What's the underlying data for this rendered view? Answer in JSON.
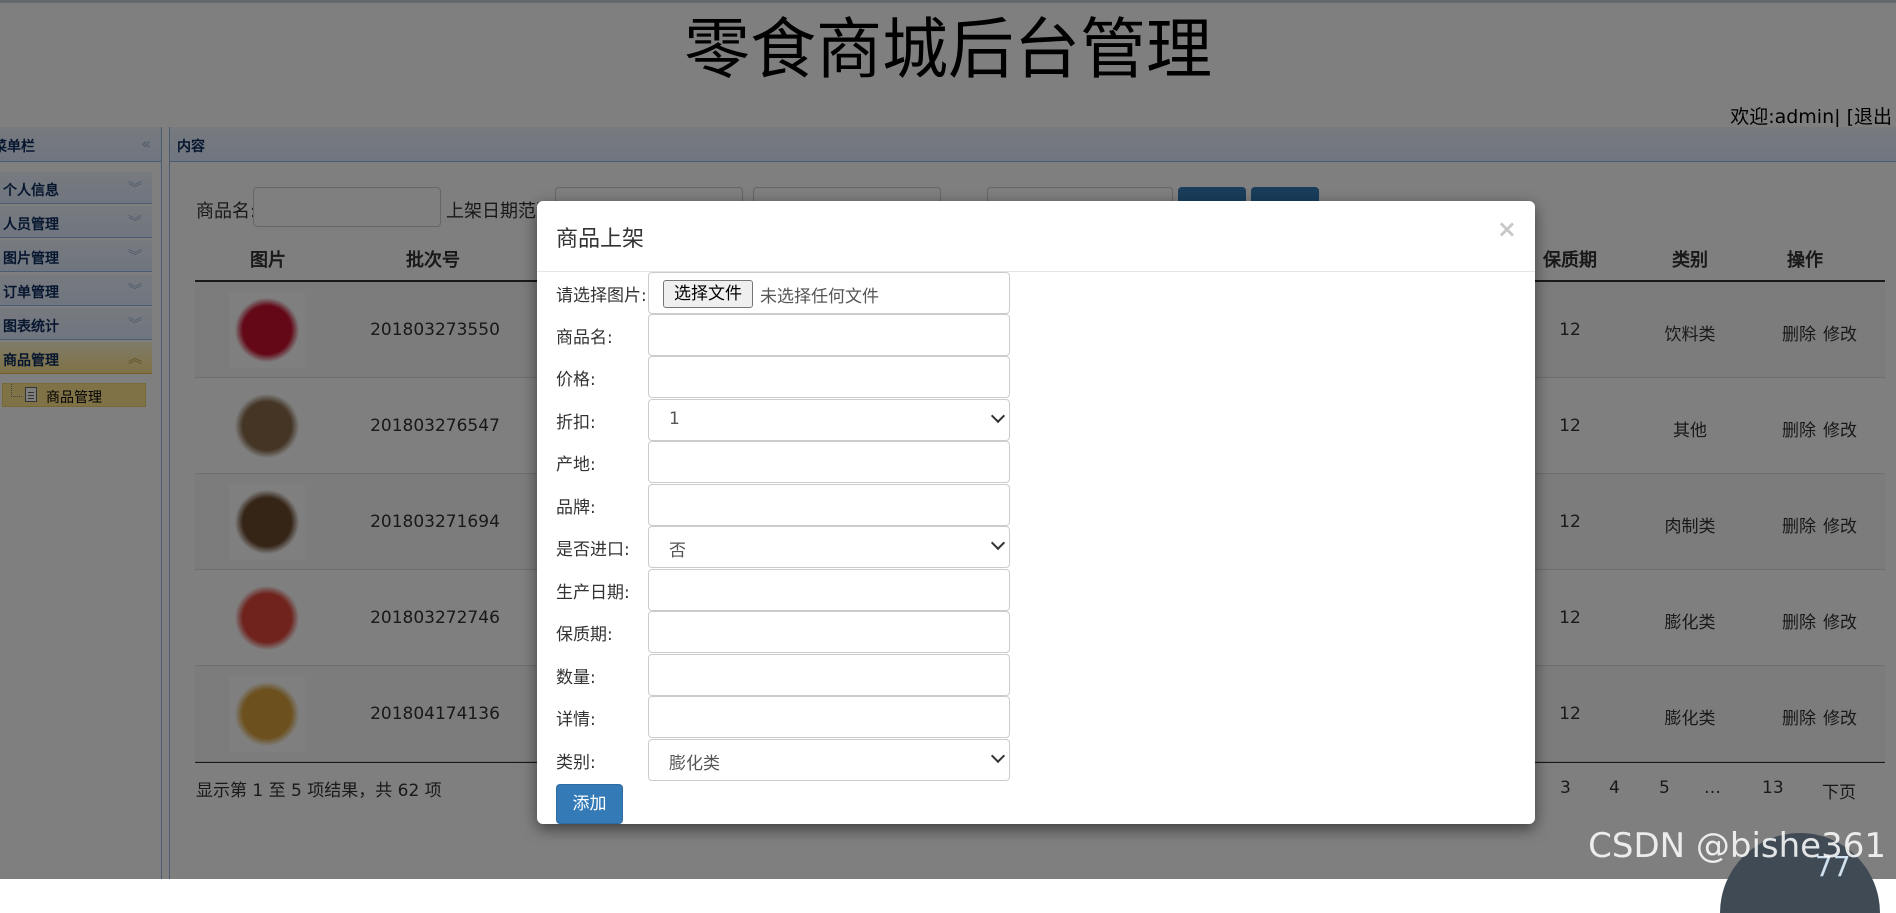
{
  "header": {
    "title": "零食商城后台管理",
    "welcome": "欢迎:admin|",
    "logout": "[退出"
  },
  "sidebar": {
    "title": "菜单栏",
    "items": [
      {
        "label": "个人信息"
      },
      {
        "label": "人员管理"
      },
      {
        "label": "图片管理"
      },
      {
        "label": "订单管理"
      },
      {
        "label": "图表统计"
      },
      {
        "label": "商品管理"
      }
    ],
    "tree_item": "商品管理"
  },
  "content": {
    "title": "内容",
    "filter": {
      "name_label": "商品名:",
      "date_label": "上架日期范围"
    },
    "columns": [
      "图片",
      "批次号",
      "保质期",
      "类别",
      "操作"
    ],
    "rows": [
      {
        "batch": "201803273550",
        "shelf": "12",
        "category": "饮料类",
        "del": "删除",
        "edit": "修改",
        "thumb_color": "#c8102e"
      },
      {
        "batch": "201803276547",
        "shelf": "12",
        "category": "其他",
        "del": "删除",
        "edit": "修改",
        "thumb_color": "#8a6b4a"
      },
      {
        "batch": "201803271694",
        "shelf": "12",
        "category": "肉制类",
        "del": "删除",
        "edit": "修改",
        "thumb_color": "#6b4a2e"
      },
      {
        "batch": "201803272746",
        "shelf": "12",
        "category": "膨化类",
        "del": "删除",
        "edit": "修改",
        "thumb_color": "#e0453a"
      },
      {
        "batch": "201804174136",
        "shelf": "12",
        "category": "膨化类",
        "del": "删除",
        "edit": "修改",
        "thumb_color": "#d9a23d"
      }
    ],
    "pager": {
      "summary": "显示第 1 至 5 项结果，共 62 项",
      "pages": [
        "3",
        "4",
        "5",
        "…",
        "13"
      ],
      "next": "下页"
    }
  },
  "modal": {
    "title": "商品上架",
    "close": "×",
    "fields": {
      "image": {
        "label": "请选择图片:",
        "button": "选择文件",
        "status": "未选择任何文件"
      },
      "name": {
        "label": "商品名:",
        "value": ""
      },
      "price": {
        "label": "价格:",
        "value": ""
      },
      "discount": {
        "label": "折扣:",
        "value": "1"
      },
      "origin": {
        "label": "产地:",
        "value": ""
      },
      "brand": {
        "label": "品牌:",
        "value": ""
      },
      "imported": {
        "label": "是否进口:",
        "value": "否"
      },
      "production_date": {
        "label": "生产日期:",
        "value": ""
      },
      "shelf_life": {
        "label": "保质期:",
        "value": ""
      },
      "quantity": {
        "label": "数量:",
        "value": ""
      },
      "details": {
        "label": "详情:",
        "value": ""
      },
      "category": {
        "label": "类别:",
        "value": "膨化类"
      }
    },
    "submit": "添加"
  },
  "watermark": "CSDN @bishe361",
  "gauge": "77"
}
